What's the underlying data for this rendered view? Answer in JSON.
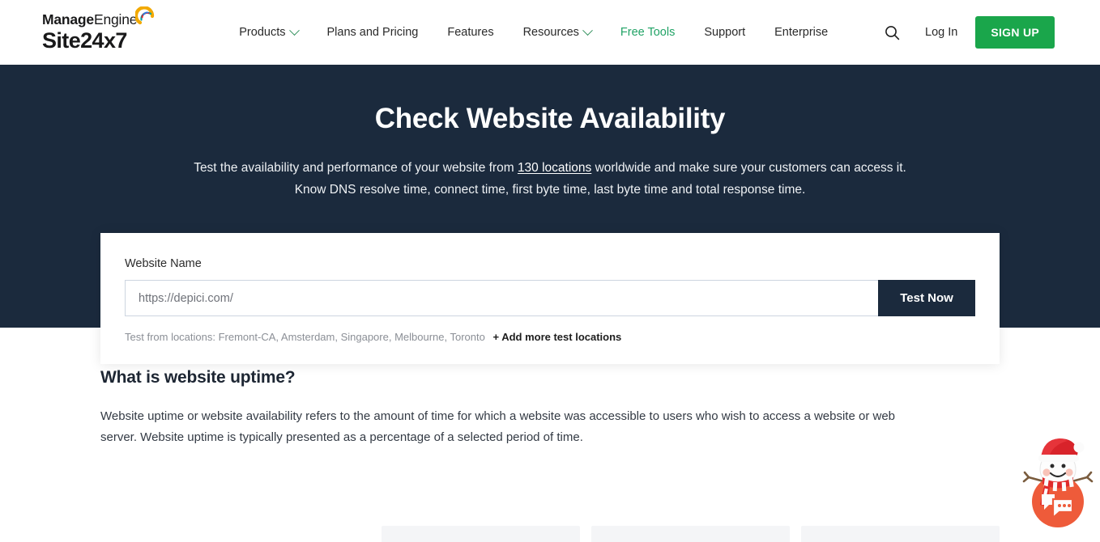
{
  "header": {
    "logo": {
      "manage": "Manage",
      "engine": "Engine",
      "product": "Site24x7",
      "swoosh_icon": "manageengine-swoosh-icon"
    },
    "nav": [
      {
        "label": "Products",
        "has_chevron": true,
        "highlight": false
      },
      {
        "label": "Plans and Pricing",
        "has_chevron": false,
        "highlight": false
      },
      {
        "label": "Features",
        "has_chevron": false,
        "highlight": false
      },
      {
        "label": "Resources",
        "has_chevron": true,
        "highlight": false
      },
      {
        "label": "Free Tools",
        "has_chevron": false,
        "highlight": true
      },
      {
        "label": "Support",
        "has_chevron": false,
        "highlight": false
      },
      {
        "label": "Enterprise",
        "has_chevron": false,
        "highlight": false
      }
    ],
    "search_icon": "search-icon",
    "login_label": "Log In",
    "signup_label": "SIGN UP",
    "accent_green": "#1aa64b",
    "link_green": "#21a366"
  },
  "hero": {
    "title": "Check Website Availability",
    "desc_part1": "Test the availability and performance of your website from ",
    "desc_link": "130 locations",
    "desc_part2": " worldwide and make sure your customers can access it. Know DNS resolve time, connect time, first byte time, last byte time and total response time.",
    "background": "#1b2a3d"
  },
  "form": {
    "label": "Website Name",
    "input_value": "https://depici.com/",
    "input_placeholder": "https://depici.com/",
    "submit_label": "Test Now",
    "locations_prefix": "Test from locations: Fremont-CA, Amsterdam, Singapore, Melbourne, Toronto",
    "add_locations_label": "+ Add more test locations",
    "submit_bg": "#1b2a3d"
  },
  "article": {
    "heading": "What is website uptime?",
    "body": "Website uptime or website availability refers to the amount of time for which a website was accessible to users who wish to access a website or web server. Website uptime is typically presented as a percentage of a selected period of time."
  },
  "peek_cards": [
    {
      "name": "card-1"
    },
    {
      "name": "card-2"
    },
    {
      "name": "card-3"
    }
  ],
  "chat_widget": {
    "icon": "snowman-chat-icon",
    "bubble_color": "#ee5b3a",
    "hat_color": "#d8232a"
  }
}
